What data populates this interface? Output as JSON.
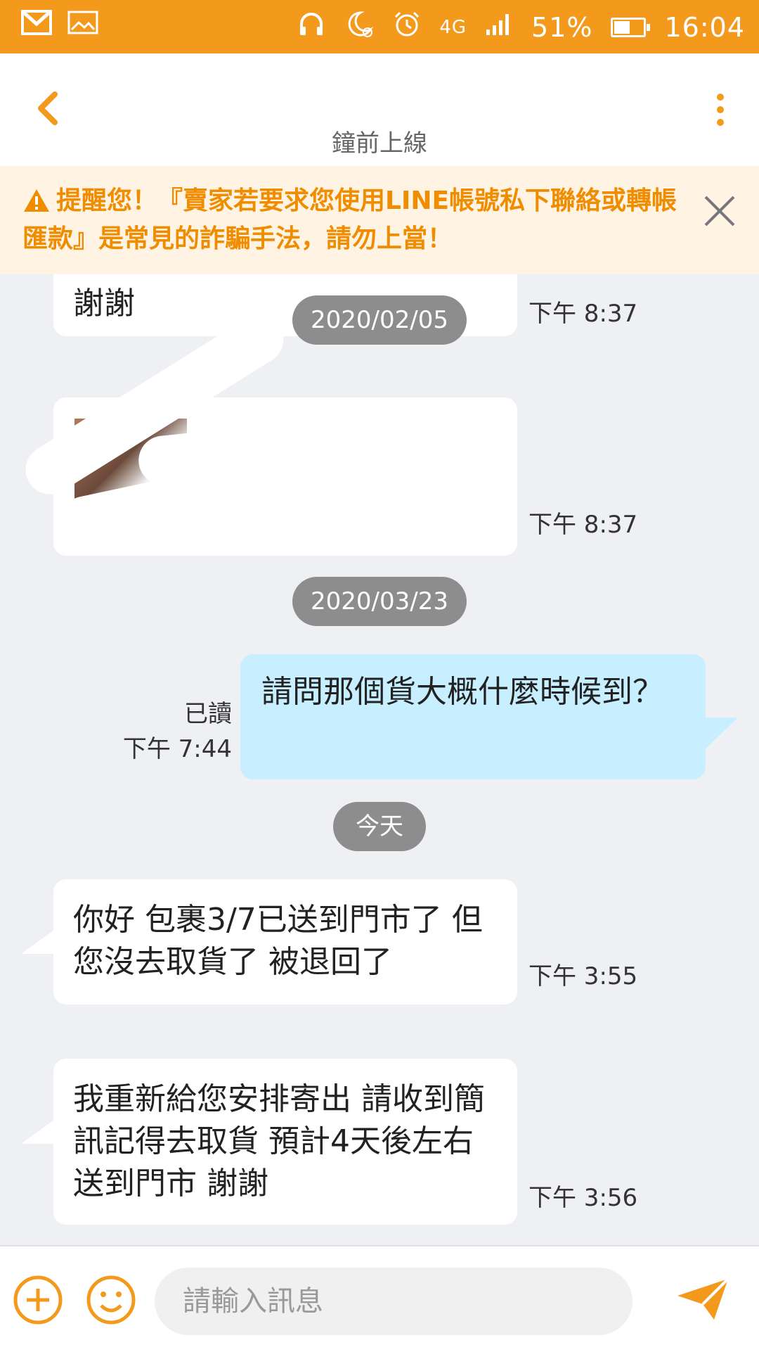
{
  "status_bar": {
    "battery": "51%",
    "battery_level": 0.51,
    "time": "16:04",
    "network": "4G"
  },
  "header": {
    "subtitle": "鐘前上線"
  },
  "warning": {
    "text": "提醒您！『賣家若要求您使用LINE帳號私下聯絡或轉帳匯款』是常見的詐騙手法，請勿上當！"
  },
  "messages": {
    "m1": {
      "text": "謝謝",
      "time": "下午 8:37"
    },
    "date1": "2020/02/05",
    "m2": {
      "time": "下午 8:37"
    },
    "date2": "2020/03/23",
    "m3": {
      "text": "請問那個貨大概什麼時候到？",
      "read": "已讀",
      "time": "下午 7:44"
    },
    "date3": "今天",
    "m4": {
      "text": "你好 包裹3/7已送到門市了 但您沒去取貨了 被退回了",
      "time": "下午 3:55"
    },
    "m5": {
      "text": "我重新給您安排寄出 請收到簡訊記得去取貨 預計4天後左右送到門市 謝謝",
      "time": "下午 3:56"
    }
  },
  "input": {
    "placeholder": "請輸入訊息"
  },
  "colors": {
    "accent": "#f39a1c",
    "outgoing_bubble": "#c7efff",
    "warning_bg": "#fff4e3",
    "warning_text": "#f08c00"
  }
}
